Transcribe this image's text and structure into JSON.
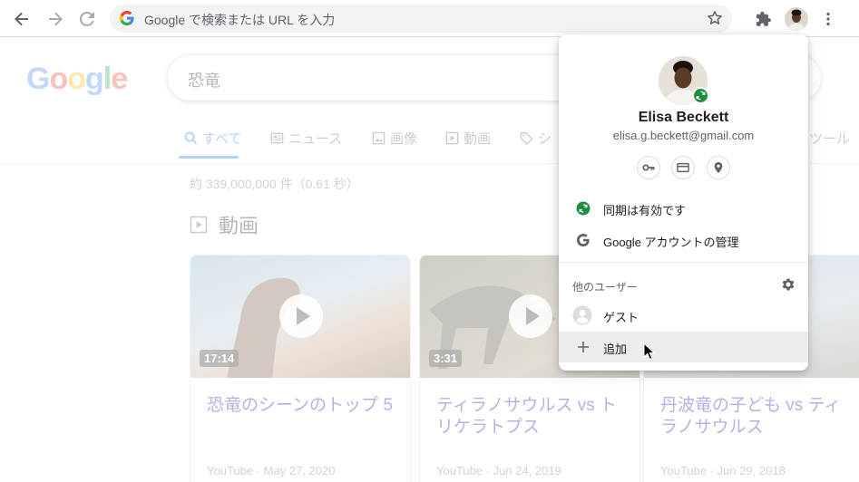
{
  "browser": {
    "omnibox_placeholder": "Google で検索または URL を入力"
  },
  "page": {
    "logo": [
      "G",
      "o",
      "o",
      "g",
      "l",
      "e"
    ],
    "logo_colors": [
      "#4285f4",
      "#ea4335",
      "#fbbc05",
      "#4285f4",
      "#34a853",
      "#ea4335"
    ],
    "search_query": "恐竜",
    "tabs": [
      {
        "label": "すべて",
        "icon": "search-icon"
      },
      {
        "label": "ニュース",
        "icon": "news-icon"
      },
      {
        "label": "画像",
        "icon": "image-icon"
      },
      {
        "label": "動画",
        "icon": "video-icon"
      },
      {
        "label": "シ",
        "icon": "tag-icon"
      },
      {
        "label": "ツール",
        "icon": ""
      }
    ],
    "result_stats": "約 339,000,000 件（0.61 秒）",
    "videos_heading": "動画",
    "videos": [
      {
        "duration": "17:14",
        "title": "恐竜のシーンのトップ 5",
        "source": "YouTube",
        "date": "May 27, 2020"
      },
      {
        "duration": "3:31",
        "title": "ティラノサウルス vs トリケラトプス",
        "source": "YouTube",
        "date": "Jun 24, 2019"
      },
      {
        "duration": "",
        "title": "丹波竜の子ども vs ティラノサウルス",
        "source": "YouTube",
        "date": "Jun 29, 2018"
      }
    ]
  },
  "profile_menu": {
    "name": "Elisa Beckett",
    "email": "elisa.g.beckett@gmail.com",
    "quick_buttons": [
      "key-icon",
      "credit-card-icon",
      "location-pin-icon"
    ],
    "sync_label": "同期は有効です",
    "manage_account_label": "Google アカウントの管理",
    "other_users_label": "他のユーザー",
    "guest_label": "ゲスト",
    "add_label": "追加",
    "sync_color": "#1e8e3e"
  }
}
